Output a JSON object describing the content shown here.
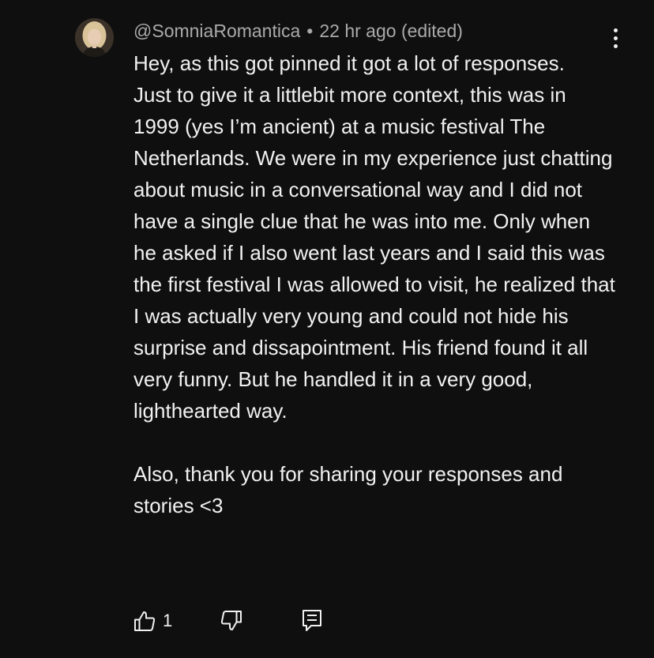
{
  "comment": {
    "author": "@SomniaRomantica",
    "separator": "•",
    "time": "22 hr ago",
    "edited": "(edited)",
    "paragraphs": [
      "Hey, as this got pinned it got a lot of responses.",
      "Just to give it a littlebit more context, this was in 1999 (yes I’m ancient) at a music festival The Netherlands. We were in my experience just chatting about music in a conversational way and I did not have a single clue that he was into me. Only when he asked if I also went last years and I said this was the first festival I was allowed to visit, he realized that I was actually very young and could not hide his surprise and dissapointment. His friend found it all very funny. But he handled it in a very good, lighthearted way.",
      "Also, thank you for sharing your responses and stories <3"
    ],
    "like_count": "1",
    "icons": {
      "avatar": "avatar-photo",
      "menu": "more-vertical-icon",
      "like": "thumbs-up-icon",
      "dislike": "thumbs-down-icon",
      "reply": "reply-comment-icon"
    },
    "colors": {
      "background": "#0f0f0f",
      "text": "#f1f1f1",
      "meta": "#aaaaaa"
    }
  }
}
